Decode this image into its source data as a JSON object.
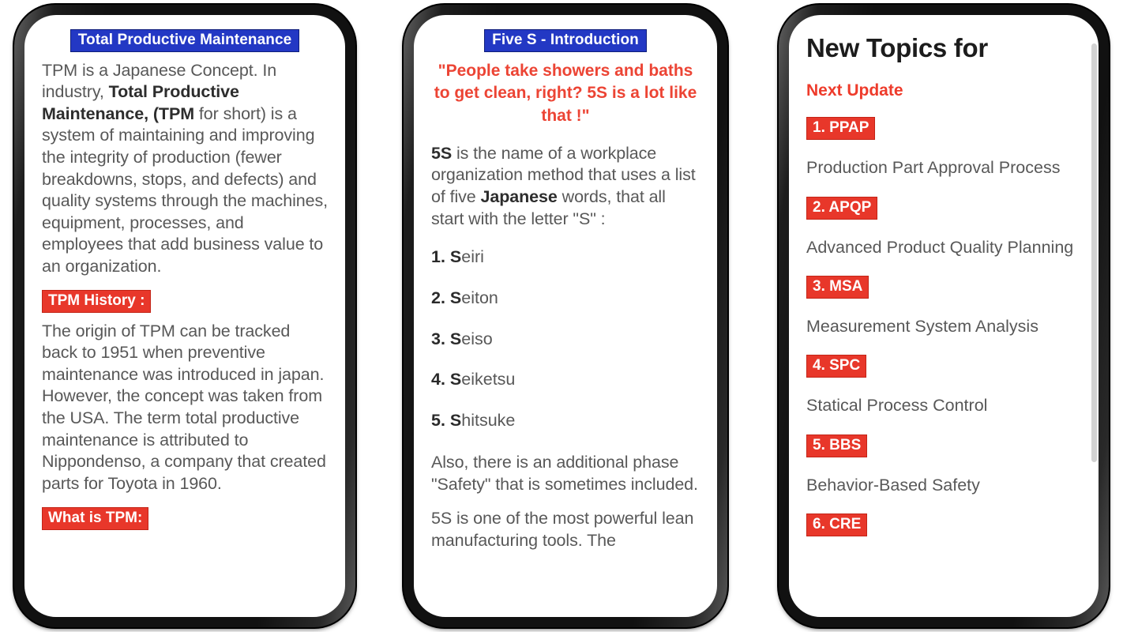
{
  "meta": {
    "background": "#ffffff",
    "accent_blue": "#2338c4",
    "accent_red": "#e8372a",
    "body_text": "#585858"
  },
  "panels": [
    {
      "id": "tpm",
      "header": "Total Productive Maintenance",
      "paragraph_1": {
        "part_1": "TPM is a Japanese Concept. In industry, ",
        "bold_1": "Total Productive Maintenance, (TPM",
        "part_2": " for short) is a system of maintaining and improving the integrity of production (fewer breakdowns, stops, and defects) and quality systems through the machines, equipment, processes, and employees that add business value to an organization."
      },
      "tag_history": "TPM History :",
      "paragraph_2": "The origin of TPM can be tracked back to 1951 when preventive maintenance was introduced in japan. However, the concept was taken from the USA. The term total productive maintenance is attributed to Nippondenso, a company that created parts for Toyota in 1960.",
      "tag_what_is": "What is TPM:"
    },
    {
      "id": "five-s",
      "header": "Five S - Introduction",
      "quote": "\"People take showers and baths to get clean, right? 5S is a lot like that !\"",
      "paragraph_1": {
        "bold_1": "5S",
        "part_1": " is the name of a workplace organization method that uses a list of five ",
        "bold_2": "Japanese",
        "part_2": " words, that all start with the letter \"S\" :"
      },
      "list": [
        {
          "num": "1. S",
          "rest": "eiri"
        },
        {
          "num": "2. S",
          "rest": "eiton"
        },
        {
          "num": "3. S",
          "rest": "eiso"
        },
        {
          "num": "4. S",
          "rest": "eiketsu"
        },
        {
          "num": "5. S",
          "rest": "hitsuke"
        }
      ],
      "paragraph_2": "Also, there is an additional phase \"Safety\" that is sometimes included.",
      "paragraph_3": "5S is one of the most powerful lean manufacturing tools. The"
    },
    {
      "id": "new-topics",
      "title": "New Topics for",
      "subtitle": "Next Update",
      "topics": [
        {
          "tag": "1. PPAP",
          "desc": "Production Part Approval Process"
        },
        {
          "tag": "2. APQP",
          "desc": "Advanced Product Quality Planning"
        },
        {
          "tag": "3. MSA",
          "desc": "Measurement System Analysis"
        },
        {
          "tag": "4. SPC",
          "desc": "Statical Process Control"
        },
        {
          "tag": "5. BBS",
          "desc": "Behavior-Based Safety"
        },
        {
          "tag": "6. CRE",
          "desc": ""
        }
      ]
    }
  ]
}
